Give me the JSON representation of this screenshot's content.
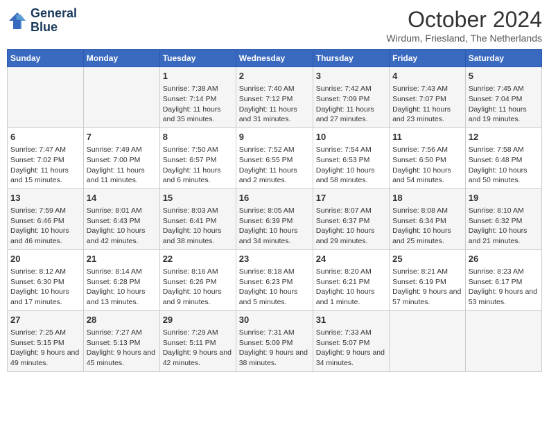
{
  "header": {
    "logo_line1": "General",
    "logo_line2": "Blue",
    "month_title": "October 2024",
    "subtitle": "Wirdum, Friesland, The Netherlands"
  },
  "days_of_week": [
    "Sunday",
    "Monday",
    "Tuesday",
    "Wednesday",
    "Thursday",
    "Friday",
    "Saturday"
  ],
  "weeks": [
    [
      {
        "day": "",
        "content": ""
      },
      {
        "day": "",
        "content": ""
      },
      {
        "day": "1",
        "content": "Sunrise: 7:38 AM\nSunset: 7:14 PM\nDaylight: 11 hours and 35 minutes."
      },
      {
        "day": "2",
        "content": "Sunrise: 7:40 AM\nSunset: 7:12 PM\nDaylight: 11 hours and 31 minutes."
      },
      {
        "day": "3",
        "content": "Sunrise: 7:42 AM\nSunset: 7:09 PM\nDaylight: 11 hours and 27 minutes."
      },
      {
        "day": "4",
        "content": "Sunrise: 7:43 AM\nSunset: 7:07 PM\nDaylight: 11 hours and 23 minutes."
      },
      {
        "day": "5",
        "content": "Sunrise: 7:45 AM\nSunset: 7:04 PM\nDaylight: 11 hours and 19 minutes."
      }
    ],
    [
      {
        "day": "6",
        "content": "Sunrise: 7:47 AM\nSunset: 7:02 PM\nDaylight: 11 hours and 15 minutes."
      },
      {
        "day": "7",
        "content": "Sunrise: 7:49 AM\nSunset: 7:00 PM\nDaylight: 11 hours and 11 minutes."
      },
      {
        "day": "8",
        "content": "Sunrise: 7:50 AM\nSunset: 6:57 PM\nDaylight: 11 hours and 6 minutes."
      },
      {
        "day": "9",
        "content": "Sunrise: 7:52 AM\nSunset: 6:55 PM\nDaylight: 11 hours and 2 minutes."
      },
      {
        "day": "10",
        "content": "Sunrise: 7:54 AM\nSunset: 6:53 PM\nDaylight: 10 hours and 58 minutes."
      },
      {
        "day": "11",
        "content": "Sunrise: 7:56 AM\nSunset: 6:50 PM\nDaylight: 10 hours and 54 minutes."
      },
      {
        "day": "12",
        "content": "Sunrise: 7:58 AM\nSunset: 6:48 PM\nDaylight: 10 hours and 50 minutes."
      }
    ],
    [
      {
        "day": "13",
        "content": "Sunrise: 7:59 AM\nSunset: 6:46 PM\nDaylight: 10 hours and 46 minutes."
      },
      {
        "day": "14",
        "content": "Sunrise: 8:01 AM\nSunset: 6:43 PM\nDaylight: 10 hours and 42 minutes."
      },
      {
        "day": "15",
        "content": "Sunrise: 8:03 AM\nSunset: 6:41 PM\nDaylight: 10 hours and 38 minutes."
      },
      {
        "day": "16",
        "content": "Sunrise: 8:05 AM\nSunset: 6:39 PM\nDaylight: 10 hours and 34 minutes."
      },
      {
        "day": "17",
        "content": "Sunrise: 8:07 AM\nSunset: 6:37 PM\nDaylight: 10 hours and 29 minutes."
      },
      {
        "day": "18",
        "content": "Sunrise: 8:08 AM\nSunset: 6:34 PM\nDaylight: 10 hours and 25 minutes."
      },
      {
        "day": "19",
        "content": "Sunrise: 8:10 AM\nSunset: 6:32 PM\nDaylight: 10 hours and 21 minutes."
      }
    ],
    [
      {
        "day": "20",
        "content": "Sunrise: 8:12 AM\nSunset: 6:30 PM\nDaylight: 10 hours and 17 minutes."
      },
      {
        "day": "21",
        "content": "Sunrise: 8:14 AM\nSunset: 6:28 PM\nDaylight: 10 hours and 13 minutes."
      },
      {
        "day": "22",
        "content": "Sunrise: 8:16 AM\nSunset: 6:26 PM\nDaylight: 10 hours and 9 minutes."
      },
      {
        "day": "23",
        "content": "Sunrise: 8:18 AM\nSunset: 6:23 PM\nDaylight: 10 hours and 5 minutes."
      },
      {
        "day": "24",
        "content": "Sunrise: 8:20 AM\nSunset: 6:21 PM\nDaylight: 10 hours and 1 minute."
      },
      {
        "day": "25",
        "content": "Sunrise: 8:21 AM\nSunset: 6:19 PM\nDaylight: 9 hours and 57 minutes."
      },
      {
        "day": "26",
        "content": "Sunrise: 8:23 AM\nSunset: 6:17 PM\nDaylight: 9 hours and 53 minutes."
      }
    ],
    [
      {
        "day": "27",
        "content": "Sunrise: 7:25 AM\nSunset: 5:15 PM\nDaylight: 9 hours and 49 minutes."
      },
      {
        "day": "28",
        "content": "Sunrise: 7:27 AM\nSunset: 5:13 PM\nDaylight: 9 hours and 45 minutes."
      },
      {
        "day": "29",
        "content": "Sunrise: 7:29 AM\nSunset: 5:11 PM\nDaylight: 9 hours and 42 minutes."
      },
      {
        "day": "30",
        "content": "Sunrise: 7:31 AM\nSunset: 5:09 PM\nDaylight: 9 hours and 38 minutes."
      },
      {
        "day": "31",
        "content": "Sunrise: 7:33 AM\nSunset: 5:07 PM\nDaylight: 9 hours and 34 minutes."
      },
      {
        "day": "",
        "content": ""
      },
      {
        "day": "",
        "content": ""
      }
    ]
  ]
}
